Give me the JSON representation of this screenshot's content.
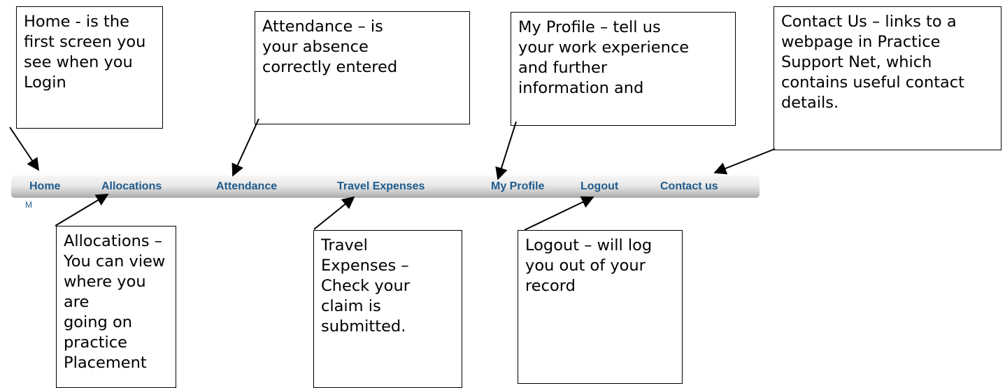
{
  "nav": {
    "items": [
      {
        "label": "Home"
      },
      {
        "label": "Allocations"
      },
      {
        "label": "Attendance"
      },
      {
        "label": "Travel Expenses"
      },
      {
        "label": "My Profile"
      },
      {
        "label": "Logout"
      },
      {
        "label": "Contact us"
      }
    ],
    "stray_text": "M"
  },
  "callouts": {
    "home": "Home - is the\nfirst screen you\nsee when you\nLogin",
    "attendance": "Attendance – is\nyour absence\ncorrectly entered",
    "my_profile": "My Profile – tell us\nyour work experience\nand further\ninformation and",
    "contact_us": "Contact Us – links to a\nwebpage in Practice\nSupport Net, which\ncontains useful contact\ndetails.",
    "allocations": "Allocations –\nYou can view\nwhere you are\ngoing on\npractice\nPlacement",
    "travel_expenses": "Travel\nExpenses –\nCheck your\nclaim is\nsubmitted.",
    "logout": "Logout – will log\nyou out of your\nrecord"
  },
  "colors": {
    "nav_text": "#1f5b8c",
    "callout_border": "#000000"
  }
}
